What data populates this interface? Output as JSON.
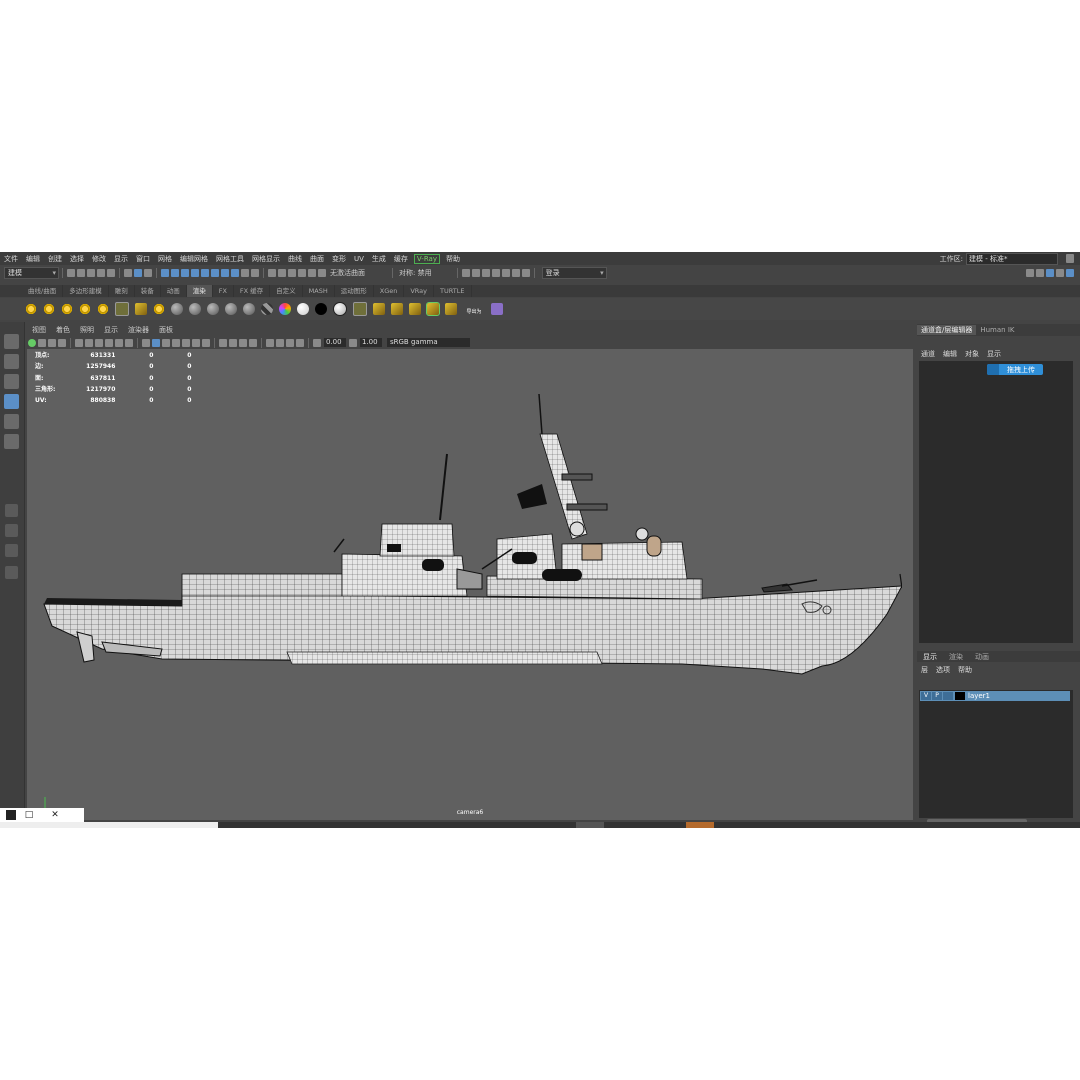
{
  "menubar": {
    "items": [
      "文件",
      "编辑",
      "创建",
      "选择",
      "修改",
      "显示",
      "窗口",
      "网格",
      "编辑网格",
      "网格工具",
      "网格显示",
      "曲线",
      "曲面",
      "变形",
      "UV",
      "生成",
      "缓存",
      "V-Ray",
      "帮助"
    ],
    "workspace_label": "工作区:",
    "workspace_value": "建模 - 标准*"
  },
  "statusline": {
    "mode": "建模",
    "no_live_surface": "无激活曲面",
    "symmetry": "对称: 禁用",
    "login": "登录"
  },
  "shelf": {
    "tabs": [
      "曲线/曲面",
      "多边形建模",
      "雕刻",
      "装备",
      "动画",
      "渲染",
      "FX",
      "FX 缓存",
      "自定义",
      "MASH",
      "运动图形",
      "XGen",
      "VRay",
      "TURTLE"
    ],
    "active_tab": "渲染",
    "export_label": "导出为"
  },
  "viewport": {
    "menu": [
      "视图",
      "着色",
      "照明",
      "显示",
      "渲染器",
      "面板"
    ],
    "exposure": "0.00",
    "gamma": "1.00",
    "colorspace": "sRGB gamma",
    "camera": "camera6",
    "hud": [
      {
        "label": "顶点:",
        "value": "631331",
        "a": "0",
        "b": "0"
      },
      {
        "label": "边:",
        "value": "1257946",
        "a": "0",
        "b": "0"
      },
      {
        "label": "面:",
        "value": "637811",
        "a": "0",
        "b": "0"
      },
      {
        "label": "三角形:",
        "value": "1217970",
        "a": "0",
        "b": "0"
      },
      {
        "label": "UV:",
        "value": "880838",
        "a": "0",
        "b": "0"
      }
    ]
  },
  "rightpanel": {
    "tabs": [
      "通道盒/层编辑器",
      "Human IK"
    ],
    "menu": [
      "通道",
      "编辑",
      "对象",
      "显示"
    ],
    "upload_label": "拖拽上传",
    "layer_tabs": [
      "显示",
      "渲染",
      "动画"
    ],
    "layer_menu": [
      "层",
      "选项",
      "帮助"
    ],
    "layer": {
      "v": "V",
      "p": "P",
      "name": "layer1"
    }
  },
  "icons": {
    "select": "select-arrow-icon",
    "lasso": "lasso-icon",
    "paint": "paint-select-icon",
    "move": "move-icon",
    "rotate": "rotate-icon",
    "scale": "scale-icon"
  },
  "colors": {
    "accent": "#5b8fc7",
    "upload": "#2f8fd8",
    "layer_selected": "#5d8fb7",
    "vray": "#7bd36b"
  }
}
